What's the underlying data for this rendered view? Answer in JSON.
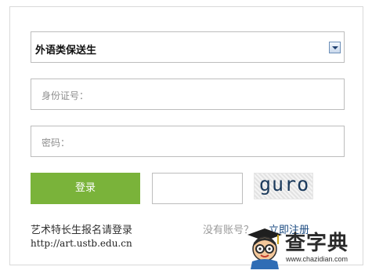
{
  "form": {
    "category_select": {
      "value": "外语类保送生"
    },
    "id_field": {
      "label": "身份证号："
    },
    "password_field": {
      "label": "密码："
    },
    "login_button": "登录",
    "captcha_text": "guro"
  },
  "footer": {
    "art_link": "艺术特长生报名请登录",
    "art_url": "http://art.ustb.edu.cn",
    "no_account": "没有账号？",
    "register": "立即注册"
  },
  "watermark": {
    "title": "查字典",
    "url": "www.chazidian.com"
  }
}
